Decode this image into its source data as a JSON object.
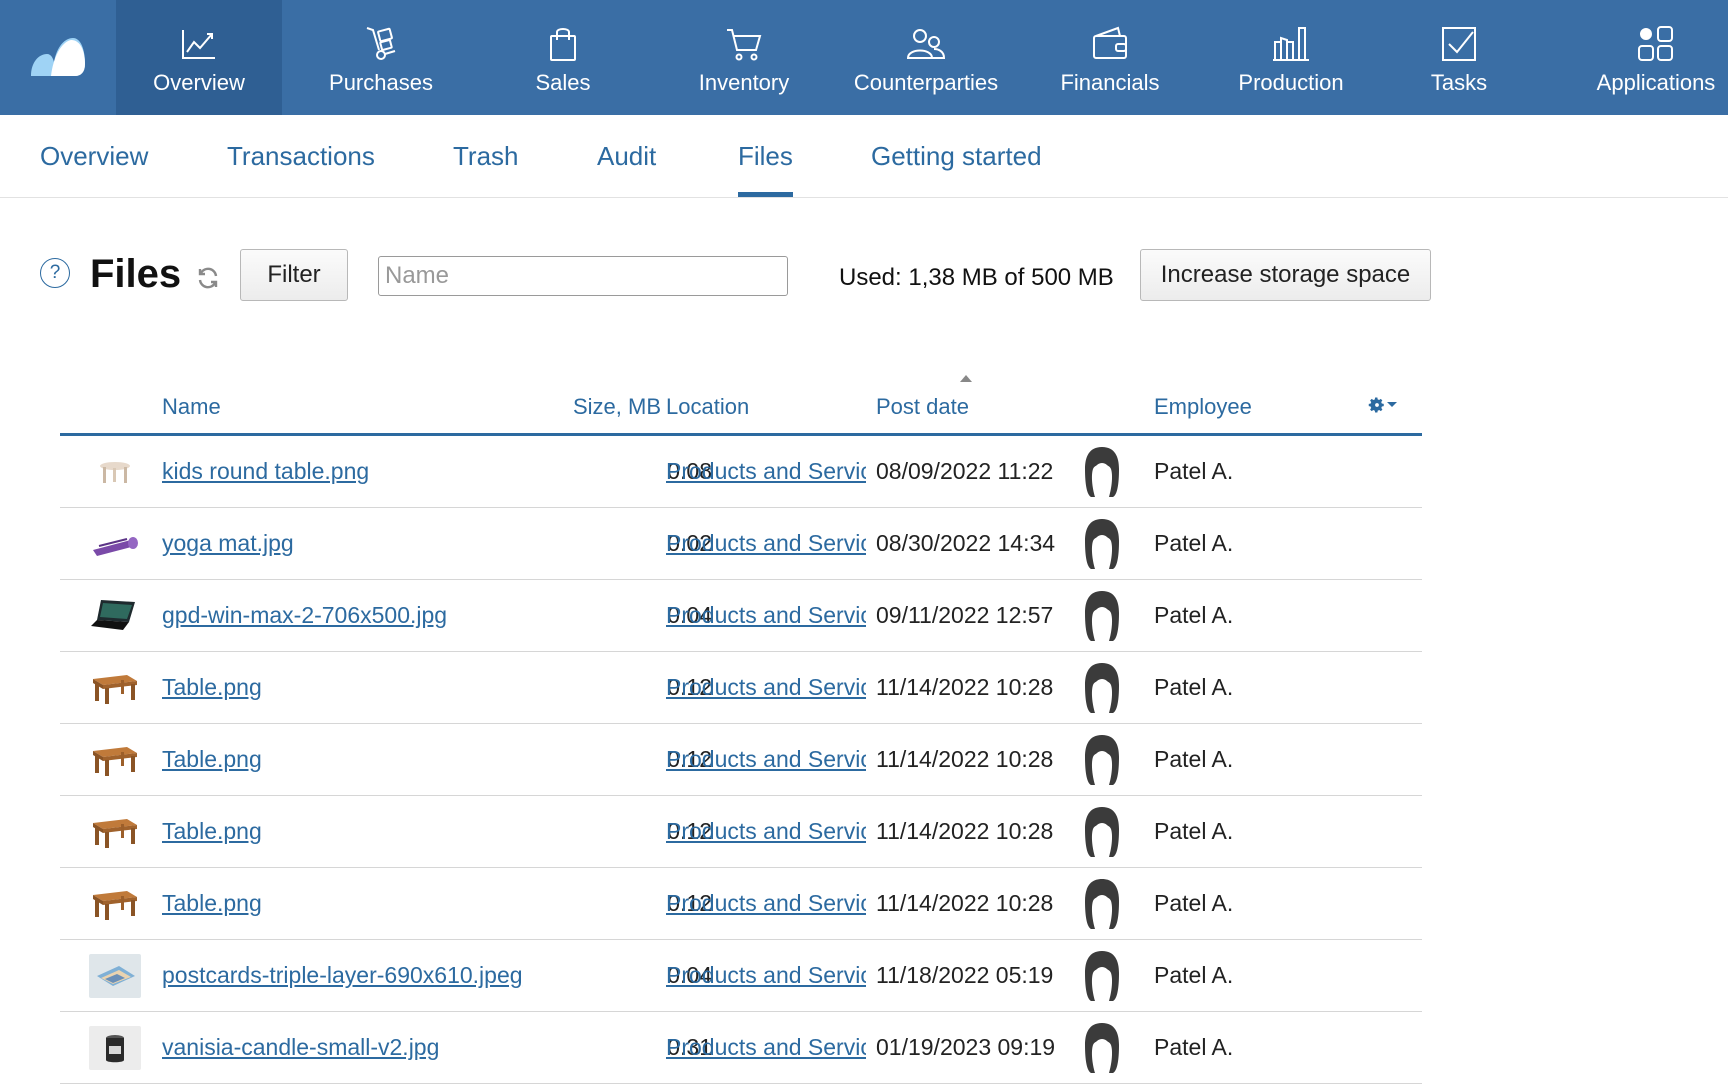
{
  "nav": {
    "items": [
      {
        "label": "Overview",
        "icon": "chart-line-icon",
        "active": true
      },
      {
        "label": "Purchases",
        "icon": "hand-truck-icon",
        "active": false
      },
      {
        "label": "Sales",
        "icon": "shopping-bag-icon",
        "active": false
      },
      {
        "label": "Inventory",
        "icon": "shopping-cart-icon",
        "active": false
      },
      {
        "label": "Counterparties",
        "icon": "people-icon",
        "active": false
      },
      {
        "label": "Financials",
        "icon": "wallet-icon",
        "active": false
      },
      {
        "label": "Production",
        "icon": "factory-icon",
        "active": false
      },
      {
        "label": "Tasks",
        "icon": "checkbox-icon",
        "active": false
      },
      {
        "label": "Applications",
        "icon": "apps-grid-icon",
        "active": false
      }
    ]
  },
  "subtabs": [
    {
      "label": "Overview",
      "active": false
    },
    {
      "label": "Transactions",
      "active": false
    },
    {
      "label": "Trash",
      "active": false
    },
    {
      "label": "Audit",
      "active": false
    },
    {
      "label": "Files",
      "active": true
    },
    {
      "label": "Getting started",
      "active": false
    }
  ],
  "toolbar": {
    "help_label": "?",
    "title": "Files",
    "filter_label": "Filter",
    "name_placeholder": "Name",
    "used_text": "Used: 1,38 MB of 500 MB",
    "storage_button": "Increase storage space"
  },
  "table": {
    "headers": {
      "name": "Name",
      "size": "Size, MB",
      "location": "Location",
      "post_date": "Post date",
      "employee": "Employee"
    },
    "sort_column": "post_date",
    "rows": [
      {
        "thumb": "kids-table-thumbnail",
        "name": "kids round table.png",
        "size": "0.08",
        "location": "Products and Service",
        "date": "08/09/2022 11:22",
        "employee": "Patel A."
      },
      {
        "thumb": "yoga-mat-thumbnail",
        "name": "yoga mat.jpg",
        "size": "0.02",
        "location": "Products and Service",
        "date": "08/30/2022 14:34",
        "employee": "Patel A."
      },
      {
        "thumb": "laptop-thumbnail",
        "name": "gpd-win-max-2-706x500.jpg",
        "size": "0.04",
        "location": "Products and Service",
        "date": "09/11/2022 12:57",
        "employee": "Patel A."
      },
      {
        "thumb": "table-thumbnail",
        "name": "Table.png",
        "size": "0.12",
        "location": "Products and Service",
        "date": "11/14/2022 10:28",
        "employee": "Patel A."
      },
      {
        "thumb": "table-thumbnail",
        "name": "Table.png",
        "size": "0.12",
        "location": "Products and Service",
        "date": "11/14/2022 10:28",
        "employee": "Patel A."
      },
      {
        "thumb": "table-thumbnail",
        "name": "Table.png",
        "size": "0.12",
        "location": "Products and Service",
        "date": "11/14/2022 10:28",
        "employee": "Patel A."
      },
      {
        "thumb": "table-thumbnail",
        "name": "Table.png",
        "size": "0.12",
        "location": "Products and Service",
        "date": "11/14/2022 10:28",
        "employee": "Patel A."
      },
      {
        "thumb": "postcards-thumbnail",
        "name": "postcards-triple-layer-690x610.jpeg",
        "size": "0.04",
        "location": "Products and Service",
        "date": "11/18/2022 05:19",
        "employee": "Patel A."
      },
      {
        "thumb": "candle-thumbnail",
        "name": "vanisia-candle-small-v2.jpg",
        "size": "0.31",
        "location": "Products and Service",
        "date": "01/19/2023 09:19",
        "employee": "Patel A."
      }
    ]
  },
  "colors": {
    "nav_bg": "#3a6ea5",
    "nav_active_bg": "#2f5f93",
    "link": "#2c6aa0"
  }
}
